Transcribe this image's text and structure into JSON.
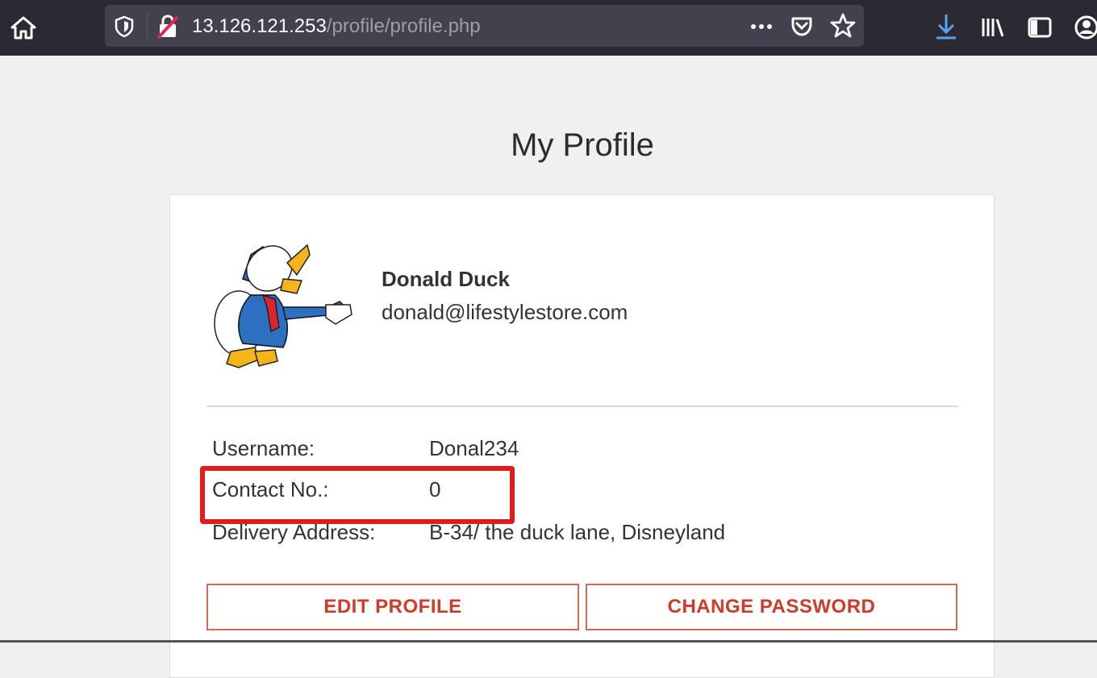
{
  "browser": {
    "url_host": "13.126.121.253",
    "url_path": "/profile/profile.php",
    "icons": [
      "home-icon",
      "shield-icon",
      "insecure-lock-icon",
      "more-icon",
      "pocket-icon",
      "star-icon",
      "download-icon",
      "library-icon",
      "sidebar-icon",
      "account-icon"
    ]
  },
  "page": {
    "title": "My Profile"
  },
  "profile": {
    "name": "Donald Duck",
    "email": "donald@lifestylestore.com",
    "fields": [
      {
        "label": "Username:",
        "value": "Donal234"
      },
      {
        "label": "Contact No.:",
        "value": "0"
      },
      {
        "label": "Delivery Address:",
        "value": "B-34/ the duck lane, Disneyland"
      }
    ]
  },
  "buttons": {
    "edit_profile": "EDIT PROFILE",
    "change_password": "CHANGE PASSWORD"
  },
  "colors": {
    "toolbar": "#2b2a33",
    "accent": "#cf3b28",
    "highlight": "#e21b1b"
  }
}
